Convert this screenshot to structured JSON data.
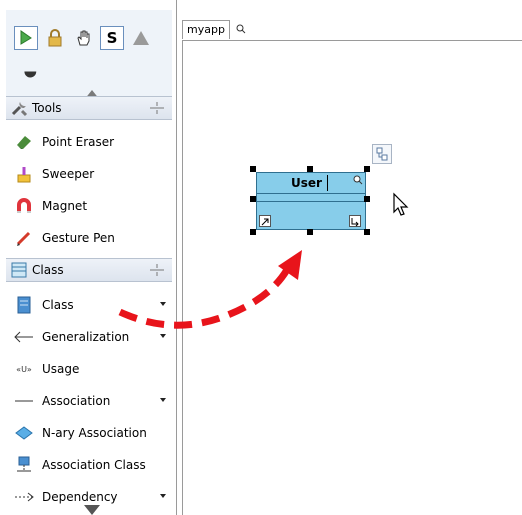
{
  "palette": {
    "sections": [
      {
        "label": "Tools",
        "items": [
          {
            "label": "Point Eraser",
            "icon": "eraser-icon"
          },
          {
            "label": "Sweeper",
            "icon": "sweeper-icon"
          },
          {
            "label": "Magnet",
            "icon": "magnet-icon"
          },
          {
            "label": "Gesture Pen",
            "icon": "pen-icon"
          }
        ]
      },
      {
        "label": "Class",
        "items": [
          {
            "label": "Class",
            "icon": "class-icon"
          },
          {
            "label": "Generalization",
            "icon": "generalization-arrow-icon"
          },
          {
            "label": "Usage",
            "icon": "usage-icon"
          },
          {
            "label": "Association",
            "icon": "association-line-icon"
          },
          {
            "label": "N-ary Association",
            "icon": "diamond-icon"
          },
          {
            "label": "Association Class",
            "icon": "association-class-icon"
          },
          {
            "label": "Dependency",
            "icon": "dependency-arrow-icon"
          }
        ]
      }
    ],
    "top_tools": [
      "select-arrow-icon",
      "lock-icon",
      "hand-icon",
      "s-icon",
      "triangle-icon"
    ]
  },
  "canvas": {
    "tab_label": "myapp",
    "class_name": "User"
  },
  "colors": {
    "class_fill": "#87cdea",
    "arrow": "#e8141b"
  }
}
